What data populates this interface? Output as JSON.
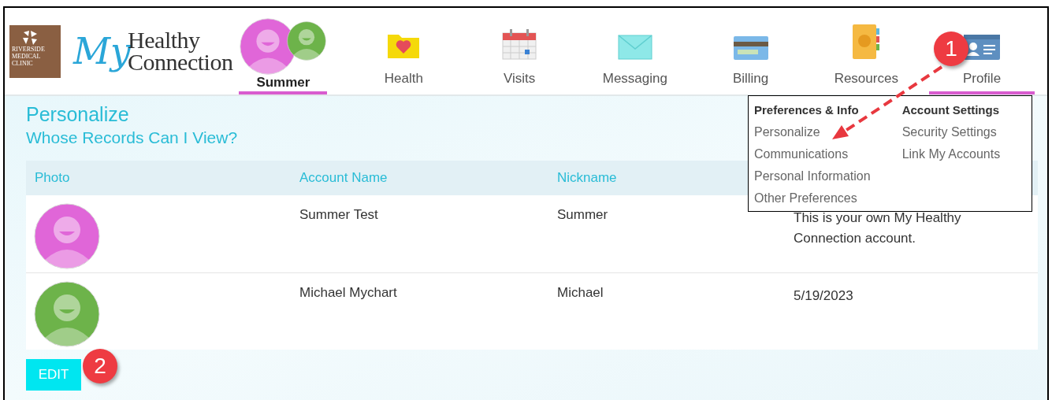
{
  "logo": {
    "clinic_lines": [
      "RIVERSIDE",
      "MEDICAL",
      "CLINIC"
    ],
    "script": "My",
    "brand_lines": [
      "Healthy",
      "Connection"
    ]
  },
  "account": {
    "name": "Summer"
  },
  "nav": [
    {
      "label": "Health",
      "kind": "health",
      "selected": false
    },
    {
      "label": "Visits",
      "kind": "visits",
      "selected": false
    },
    {
      "label": "Messaging",
      "kind": "messaging",
      "selected": false
    },
    {
      "label": "Billing",
      "kind": "billing",
      "selected": false
    },
    {
      "label": "Resources",
      "kind": "resources",
      "selected": false
    },
    {
      "label": "Profile",
      "kind": "profile",
      "selected": true
    }
  ],
  "page": {
    "title": "Personalize",
    "subtitle": "Whose Records Can I View?"
  },
  "table": {
    "columns": [
      "Photo",
      "Account Name",
      "Nickname"
    ],
    "rows": [
      {
        "color": "#e066d8",
        "account_name": "Summer Test",
        "nickname": "Summer",
        "column_4": [
          "This is your own My Healthy",
          "Connection account."
        ]
      },
      {
        "color": "#6db34a",
        "account_name": "Michael Mychart",
        "nickname": "Michael",
        "column_4": [
          "5/19/2023"
        ]
      }
    ]
  },
  "edit_button": "EDIT",
  "menu": {
    "columns": [
      {
        "heading": "Preferences & Info",
        "items": [
          "Personalize",
          "Communications",
          "Personal Information",
          "Other Preferences"
        ]
      },
      {
        "heading": "Account Settings",
        "items": [
          "Security Settings",
          "Link My Accounts"
        ]
      }
    ]
  },
  "annotations": [
    {
      "label": "1"
    },
    {
      "label": "2"
    }
  ]
}
